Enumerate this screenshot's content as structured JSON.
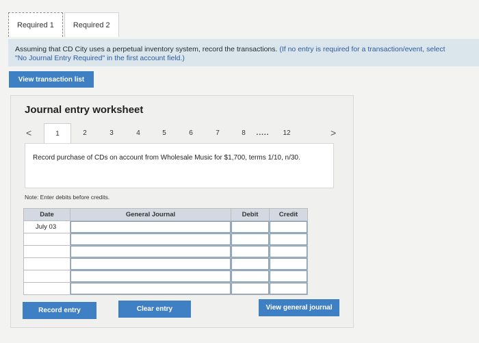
{
  "tabs": [
    {
      "label": "Required 1",
      "active": true
    },
    {
      "label": "Required 2",
      "active": false
    }
  ],
  "instruction": {
    "main": "Assuming that CD City uses a perpetual inventory system, record the transactions.",
    "hint_line1": "(If no entry is required for a transaction/event, select",
    "hint_line2": "\"No Journal Entry Required\" in the first account field.)"
  },
  "view_transaction_list_label": "View transaction list",
  "worksheet": {
    "title": "Journal entry worksheet",
    "pager": {
      "prev": "<",
      "next": ">",
      "pages": [
        "1",
        "2",
        "3",
        "4",
        "5",
        "6",
        "7",
        "8"
      ],
      "ellipsis": ".....",
      "last": "12",
      "active_index": 0
    },
    "description": "Record purchase of CDs on account from Wholesale Music for $1,700, terms 1/10, n/30.",
    "note": "Note: Enter debits before credits.",
    "table": {
      "headers": {
        "date": "Date",
        "account": "General Journal",
        "debit": "Debit",
        "credit": "Credit"
      },
      "rows": [
        {
          "date": "July 03",
          "account": "",
          "debit": "",
          "credit": ""
        },
        {
          "date": "",
          "account": "",
          "debit": "",
          "credit": ""
        },
        {
          "date": "",
          "account": "",
          "debit": "",
          "credit": ""
        },
        {
          "date": "",
          "account": "",
          "debit": "",
          "credit": ""
        },
        {
          "date": "",
          "account": "",
          "debit": "",
          "credit": ""
        },
        {
          "date": "",
          "account": "",
          "debit": "",
          "credit": ""
        }
      ]
    },
    "buttons": {
      "record": "Record entry",
      "clear": "Clear entry",
      "view_journal": "View general journal"
    }
  },
  "colors": {
    "accent": "#3f80c4",
    "instruction_bg": "#dbe5ec",
    "table_header": "#d3d9e3"
  }
}
